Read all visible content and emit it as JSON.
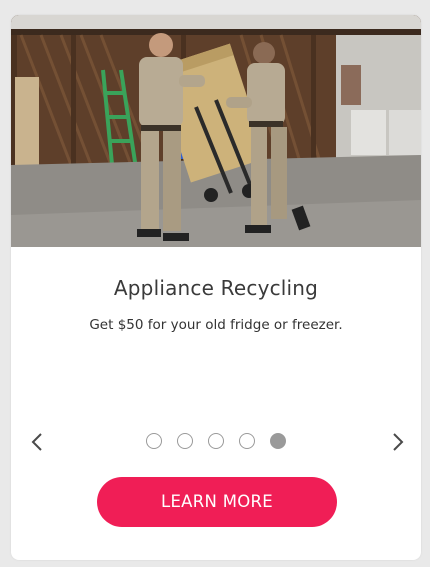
{
  "slide": {
    "title": "Appliance Recycling",
    "description": "Get $50 for your old fridge or freezer.",
    "cta_label": "LEARN MORE",
    "image_icon": "photo-two-workers-moving-fridge-on-hand-truck-in-garage"
  },
  "carousel": {
    "prev_icon": "chevron-left-icon",
    "next_icon": "chevron-right-icon",
    "dot_count": 5,
    "active_index": 4
  },
  "colors": {
    "accent": "#f01e56",
    "dot": "#9a9a9a",
    "title_text": "#3a3a3a",
    "background": "#e9e9e9",
    "card": "#ffffff"
  }
}
